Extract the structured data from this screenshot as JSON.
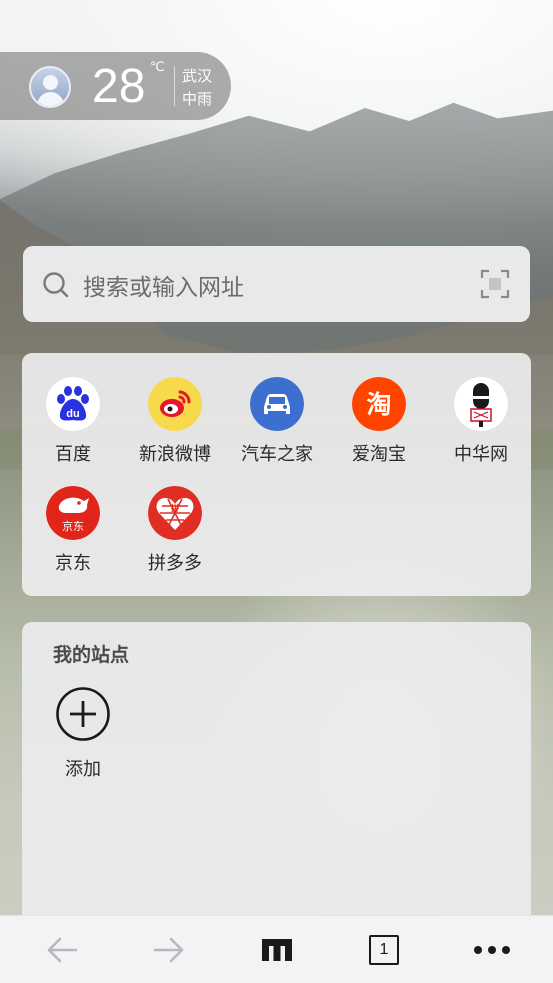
{
  "weather": {
    "temperature": "28",
    "unit": "℃",
    "city": "武汉",
    "condition": "中雨"
  },
  "search": {
    "placeholder": "搜索或输入网址",
    "icon": "search-icon",
    "scan_icon": "scan-icon"
  },
  "quick_sites": [
    {
      "label": "百度",
      "icon": "baidu-icon",
      "color": "#2932e1"
    },
    {
      "label": "新浪微博",
      "icon": "weibo-icon",
      "color": "#e6162d"
    },
    {
      "label": "汽车之家",
      "icon": "autohome-icon",
      "color": "#3c6fd0"
    },
    {
      "label": "爱淘宝",
      "icon": "taobao-icon",
      "color": "#ff4400"
    },
    {
      "label": "中华网",
      "icon": "china-com-icon",
      "color": "#c8102e"
    },
    {
      "label": "京东",
      "icon": "jd-icon",
      "color": "#e1251b"
    },
    {
      "label": "拼多多",
      "icon": "pinduoduo-icon",
      "color": "#e02e24"
    }
  ],
  "my_sites": {
    "title": "我的站点",
    "add_label": "添加"
  },
  "bottom_bar": {
    "back_icon": "back-arrow-icon",
    "forward_icon": "forward-arrow-icon",
    "home_icon": "home-icon",
    "tab_count": "1",
    "menu_icon": "more-icon"
  }
}
